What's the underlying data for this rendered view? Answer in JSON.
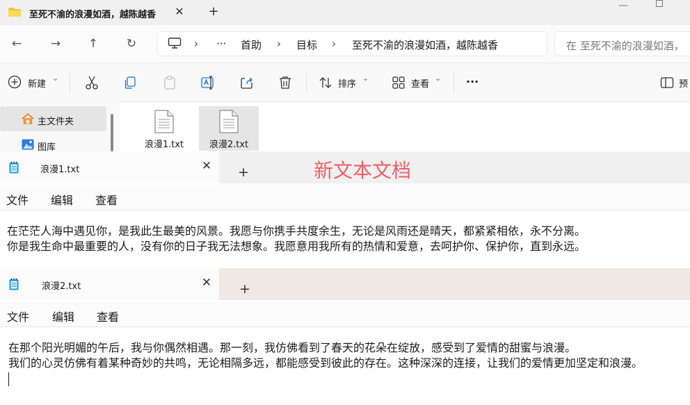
{
  "explorer": {
    "tab_title": "至死不渝的浪漫如酒，越陈越香",
    "close_glyph": "✕",
    "newtab_glyph": "+",
    "minimize_glyph": "—",
    "nav": {
      "back": "←",
      "forward": "→",
      "up": "↑",
      "refresh": "↻"
    },
    "breadcrumb": {
      "separator": "›",
      "more": "···",
      "items": [
        "首助",
        "目标",
        "至死不渝的浪漫如酒，越陈越香"
      ]
    },
    "search_placeholder": "在 至死不渝的浪漫如酒，",
    "toolbar": {
      "new_label": "新建",
      "sort_label": "排序",
      "view_label": "查看",
      "more_label": "···",
      "details_label": "预",
      "chevron": "⌄"
    },
    "nav_pane": {
      "home": "主文件夹",
      "gallery": "图库"
    },
    "files": [
      "浪漫1.txt",
      "浪漫2.txt"
    ]
  },
  "banner_text": "新文本文档",
  "notepad1": {
    "tab_title": "浪漫1.txt",
    "close_glyph": "✕",
    "newtab_glyph": "+",
    "menu": [
      "文件",
      "编辑",
      "查看"
    ],
    "lines": [
      "在茫茫人海中遇见你，是我此生最美的风景。我愿与你携手共度余生，无论是风雨还是晴天，都紧紧相依，永不分离。",
      "你是我生命中最重要的人，没有你的日子我无法想象。我愿意用我所有的热情和爱意，去呵护你、保护你，直到永远。"
    ]
  },
  "notepad2": {
    "tab_title": "浪漫2.txt",
    "close_glyph": "✕",
    "newtab_glyph": "+",
    "menu": [
      "文件",
      "编辑",
      "查看"
    ],
    "lines": [
      "在那个阳光明媚的午后，我与你偶然相遇。那一刻，我仿佛看到了春天的花朵在绽放，感受到了爱情的甜蜜与浪漫。",
      "我们的心灵仿佛有着某种奇妙的共鸣，无论相隔多远，都能感受到彼此的存在。这种深深的连接，让我们的爱情更加坚定和浪漫。"
    ]
  },
  "colors": {
    "banner": "#ee5f68",
    "notepad_icon": "#1a9fe0",
    "notepad2_strip": "#f0e9e3",
    "notepad1_strip": "#f0f0f0"
  }
}
